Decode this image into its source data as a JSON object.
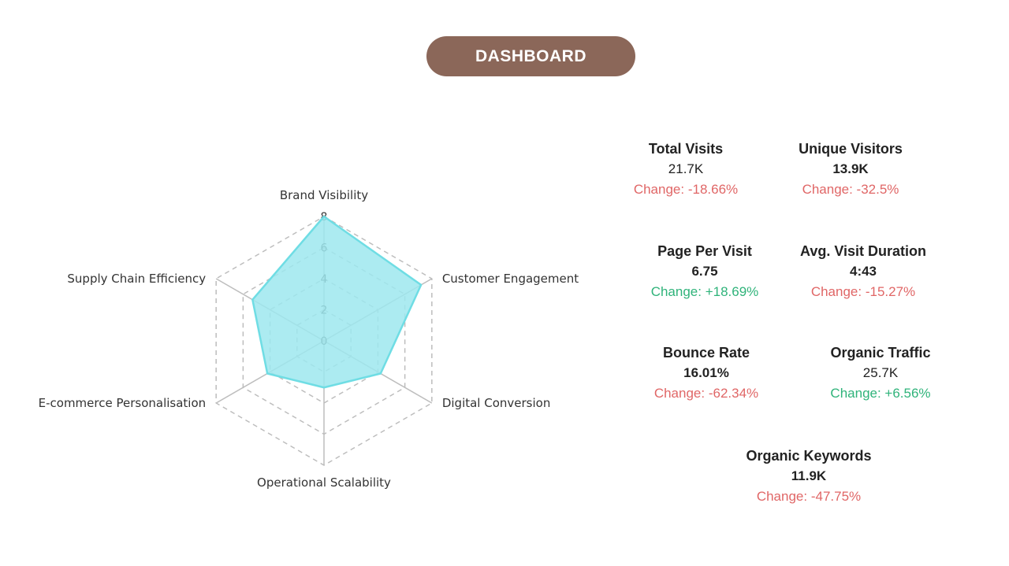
{
  "header": {
    "title": "DASHBOARD"
  },
  "colors": {
    "title_pill": "#8b6759",
    "radar_fill": "#9ee8ee",
    "radar_stroke": "#6fdde4",
    "negative_change": "#e06666",
    "positive_change": "#2fb37a",
    "grid": "#bdbdbd"
  },
  "chart_data": {
    "type": "radar",
    "title": "",
    "axes": [
      "Brand Visibility",
      "Customer Engagement",
      "Digital Conversion",
      "Operational Scalability",
      "E-commerce Personalisation",
      "Supply Chain Efficiency"
    ],
    "values": [
      8,
      7.2,
      4.2,
      3,
      4.2,
      5.3
    ],
    "radial_ticks": [
      "0",
      "2",
      "4",
      "6",
      "8"
    ],
    "rlim": [
      0,
      8
    ],
    "grid": true,
    "grid_style": "dashed"
  },
  "metrics": [
    {
      "title": "Total Visits",
      "value": "21.7K",
      "change": "Change: -18.66%",
      "trend": "neg"
    },
    {
      "title": "Unique Visitors",
      "value": "13.9K",
      "change": "Change: -32.5%",
      "trend": "neg"
    },
    {
      "title": "Page Per Visit",
      "value": "6.75",
      "change": "Change: +18.69%",
      "trend": "pos"
    },
    {
      "title": "Avg. Visit Duration",
      "value": "4:43",
      "change": "Change: -15.27%",
      "trend": "neg"
    },
    {
      "title": "Bounce Rate",
      "value": "16.01%",
      "change": "Change: -62.34%",
      "trend": "neg"
    },
    {
      "title": "Organic Traffic",
      "value": "25.7K",
      "change": "Change: +6.56%",
      "trend": "pos"
    },
    {
      "title": "Organic Keywords",
      "value": "11.9K",
      "change": "Change: -47.75%",
      "trend": "neg"
    }
  ]
}
